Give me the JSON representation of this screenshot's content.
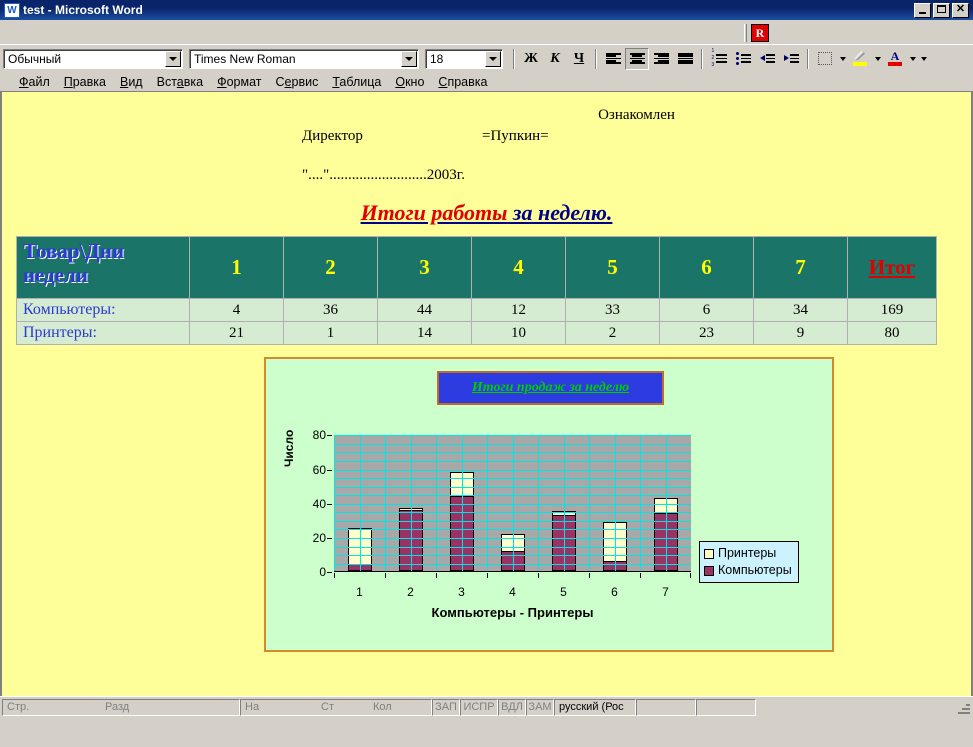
{
  "window": {
    "title": "test - Microsoft Word",
    "icon": "word-document-icon",
    "minimize_label": "Minimize",
    "maximize_label": "Maximize",
    "close_label": "Close"
  },
  "toolbar": {
    "style_value": "Обычный",
    "font_value": "Times New Roman",
    "size_value": "18",
    "bold_label": "Ж",
    "italic_label": "К",
    "underline_label": "Ч",
    "align_left_label": "По левому краю",
    "align_center_label": "По центру",
    "align_right_label": "По правому краю",
    "align_justify_label": "По ширине",
    "numbered_list_label": "Нумерованный список",
    "bulleted_list_label": "Маркированный список",
    "decrease_indent_label": "Уменьшить отступ",
    "increase_indent_label": "Увеличить отступ",
    "borders_label": "Границы",
    "highlight_label": "Выделение цветом",
    "font_color_label": "Цвет шрифта",
    "fine_reader_label": "R"
  },
  "menu": {
    "items": [
      {
        "pre": "",
        "accel": "Ф",
        "post": "айл"
      },
      {
        "pre": "",
        "accel": "П",
        "post": "равка"
      },
      {
        "pre": "",
        "accel": "В",
        "post": "ид"
      },
      {
        "pre": "Вст",
        "accel": "а",
        "post": "вка"
      },
      {
        "pre": "",
        "accel": "Ф",
        "post": "ормат"
      },
      {
        "pre": "С",
        "accel": "е",
        "post": "рвис"
      },
      {
        "pre": "",
        "accel": "Т",
        "post": "аблица"
      },
      {
        "pre": "",
        "accel": "О",
        "post": "кно"
      },
      {
        "pre": "",
        "accel": "С",
        "post": "правка"
      }
    ]
  },
  "document": {
    "header": {
      "line1": "Ознакомлен",
      "line2_label": "Директор",
      "line2_value": "=Пупкин=",
      "line3": "\"....\"..........................2003г."
    },
    "title": {
      "part_red": "Итоги работы",
      "part_blue": " за неделю."
    },
    "table": {
      "corner_header_line1": "Товар\\Дни",
      "corner_header_line2": "недели",
      "day_headers": [
        "1",
        "2",
        "3",
        "4",
        "5",
        "6",
        "7"
      ],
      "total_header": "Итог",
      "rows": [
        {
          "label": "Компьютеры:",
          "values": [
            4,
            36,
            44,
            12,
            33,
            6,
            34
          ],
          "total": 169
        },
        {
          "label": "Принтеры:",
          "values": [
            21,
            1,
            14,
            10,
            2,
            23,
            9
          ],
          "total": 80
        }
      ]
    }
  },
  "chart_data": {
    "type": "bar",
    "stacked": true,
    "title": "Итоги продаж за неделю",
    "xlabel": "Компьютеры - Принтеры",
    "ylabel": "Число",
    "categories": [
      "1",
      "2",
      "3",
      "4",
      "5",
      "6",
      "7"
    ],
    "ylim": [
      0,
      80
    ],
    "yticks": [
      0,
      20,
      40,
      60,
      80
    ],
    "grid": true,
    "legend_position": "right",
    "series": [
      {
        "name": "Компьютеры",
        "color": "#993366",
        "values": [
          4,
          36,
          44,
          12,
          33,
          6,
          34
        ]
      },
      {
        "name": "Принтеры",
        "color": "#ffffcc",
        "values": [
          21,
          1,
          14,
          10,
          2,
          23,
          9
        ]
      }
    ],
    "legend_order": [
      "Принтеры",
      "Компьютеры"
    ],
    "plot_background": "#a8a8a8",
    "grid_color": "#00e5e5",
    "chart_background": "#ccffcc",
    "title_background": "#2c3ce0",
    "title_color": "#00cc00"
  },
  "statusbar": {
    "page_label": "Стр.",
    "section_label": "Разд",
    "at_label": "На",
    "line_label": "Ст",
    "col_label": "Кол",
    "rec_label": "ЗАП",
    "trk_label": "ИСПР",
    "ext_label": "ВДЛ",
    "ovr_label": "ЗАМ",
    "language": "русский (Рос"
  }
}
